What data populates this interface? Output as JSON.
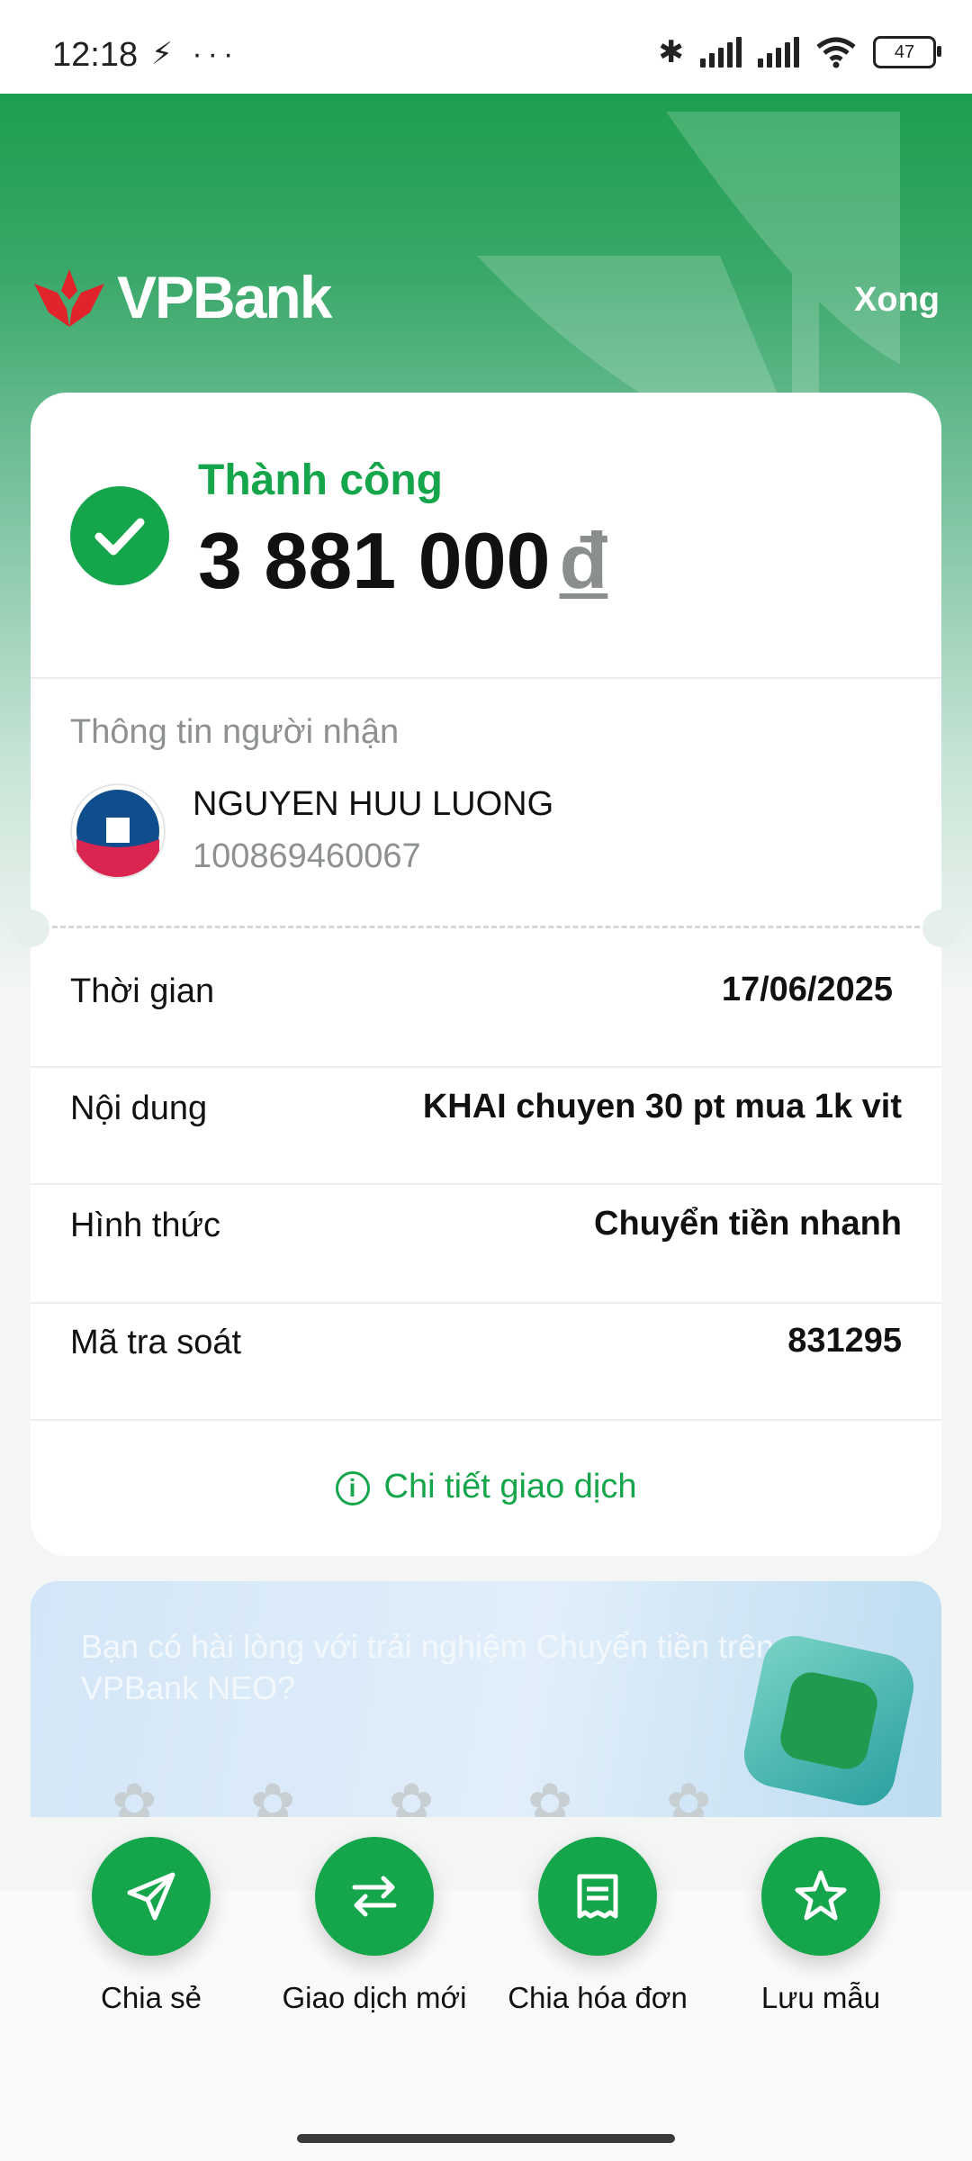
{
  "status_bar": {
    "time": "12:18",
    "left_icons": "⚡ ···",
    "battery": "47"
  },
  "header": {
    "logo_text": "VPBank",
    "done_label": "Xong"
  },
  "result": {
    "status": "Thành công",
    "amount": "3 881 000",
    "currency": "đ"
  },
  "recipient": {
    "section_title": "Thông tin người nhận",
    "name": "NGUYEN HUU LUONG",
    "account": "100869460067"
  },
  "details": [
    {
      "label": "Thời gian",
      "value": "17/06/2025"
    },
    {
      "label": "Nội dung",
      "value": "KHAI chuyen 30 pt mua 1k vit"
    },
    {
      "label": "Hình thức",
      "value": "Chuyển tiền nhanh"
    },
    {
      "label": "Mã tra soát",
      "value": "831295"
    }
  ],
  "detail_link": {
    "icon": "i",
    "label": "Chi tiết giao dịch"
  },
  "survey": {
    "text": "Bạn có hài lòng với trải nghiệm Chuyển tiền trên VPBank NEO?"
  },
  "actions": [
    {
      "label": "Chia sẻ",
      "icon": "send-icon"
    },
    {
      "label": "Giao dịch mới",
      "icon": "swap-icon"
    },
    {
      "label": "Chia hóa đơn",
      "icon": "receipt-icon"
    },
    {
      "label": "Lưu mẫu",
      "icon": "star-icon"
    }
  ],
  "colors": {
    "brand_green": "#15a54a",
    "logo_red": "#e1232b"
  }
}
